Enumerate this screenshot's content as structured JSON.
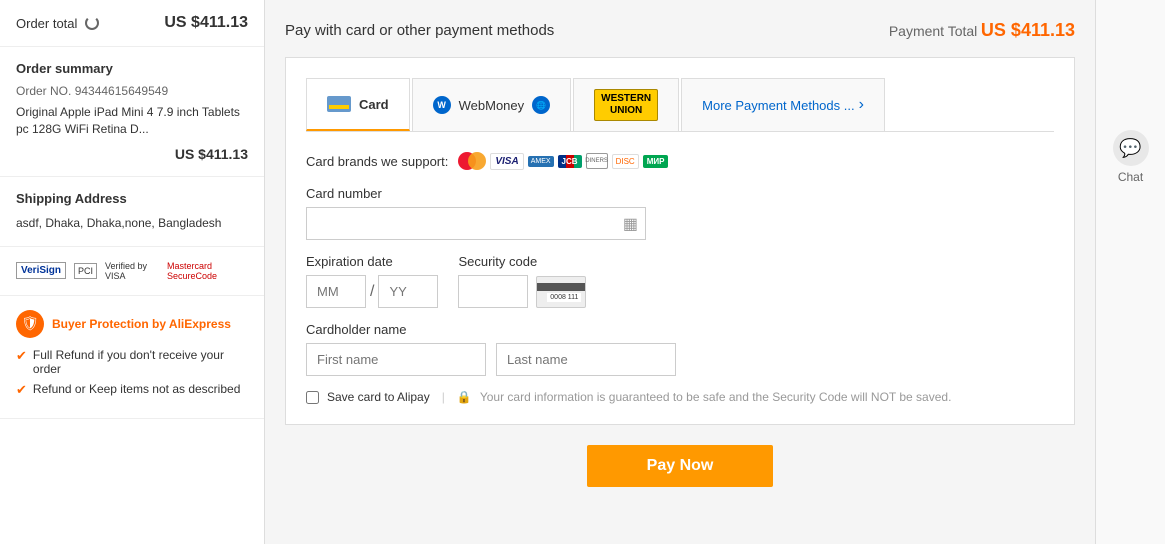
{
  "sidebar": {
    "order_total_label": "Order total",
    "order_total_amount": "US $411.13",
    "order_summary_title": "Order summary",
    "order_no_label": "Order NO.",
    "order_no_value": "94344615649549",
    "order_desc": "Original Apple iPad Mini 4 7.9 inch Tablets pc 128G WiFi Retina D...",
    "order_amount": "US $411.13",
    "shipping_title": "Shipping Address",
    "shipping_address": "asdf, Dhaka, Dhaka,none, Bangladesh",
    "bp_title": "Buyer Protection by AliExpress",
    "bp_item1_bold": "Full Refund",
    "bp_item1_text": " if you don't receive your order",
    "bp_item2_bold": "Refund or Keep",
    "bp_item2_text": " items not as described"
  },
  "payment": {
    "title": "Pay with card or other payment methods",
    "total_label": "Payment Total",
    "total_amount": "US $411.13",
    "tabs": [
      {
        "id": "card",
        "label": "Card",
        "active": true
      },
      {
        "id": "webmoney",
        "label": "WebMoney",
        "active": false
      },
      {
        "id": "westernunion",
        "label": "WESTERN UNION",
        "active": false
      },
      {
        "id": "more",
        "label": "More Payment Methods ...",
        "active": false
      }
    ],
    "card_brands_label": "Card brands we support:",
    "form": {
      "card_number_label": "Card number",
      "card_number_placeholder": "",
      "expiry_label": "Expiration date",
      "mm_placeholder": "MM",
      "yy_placeholder": "YY",
      "security_label": "Security code",
      "security_placeholder": "",
      "cardholder_label": "Cardholder name",
      "first_name_placeholder": "First name",
      "last_name_placeholder": "Last name",
      "save_card_label": "Save card to Alipay",
      "security_note": "Your card information is guaranteed to be safe and the Security Code will NOT be saved."
    }
  },
  "pay_now_button": "Pay Now",
  "chat": {
    "label": "Chat"
  }
}
